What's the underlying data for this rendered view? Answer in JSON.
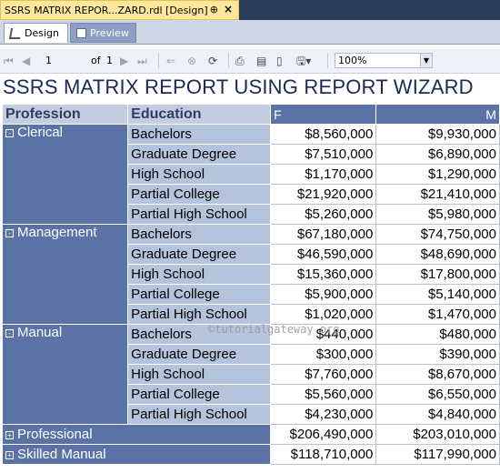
{
  "document_tab": {
    "title": "SSRS MATRIX REPOR...ZARD.rdl [Design]",
    "pin": "⊕",
    "close": "×"
  },
  "view_tabs": {
    "design": "Design",
    "preview": "Preview"
  },
  "toolbar": {
    "page": "1",
    "of_label": "of",
    "page_total": "1",
    "zoom": "100%"
  },
  "report": {
    "title": "SSRS MATRIX REPORT USING REPORT WIZARD",
    "headers": {
      "profession": "Profession",
      "education": "Education",
      "col_f": "F",
      "col_m": "M"
    },
    "groups": [
      {
        "profession": "Clerical",
        "toggle": "-",
        "rows": [
          {
            "education": "Bachelors",
            "f": "$8,560,000",
            "m": "$9,930,000"
          },
          {
            "education": "Graduate Degree",
            "f": "$7,510,000",
            "m": "$6,890,000"
          },
          {
            "education": "High School",
            "f": "$1,170,000",
            "m": "$1,290,000"
          },
          {
            "education": "Partial College",
            "f": "$21,920,000",
            "m": "$21,410,000"
          },
          {
            "education": "Partial High School",
            "f": "$5,260,000",
            "m": "$5,980,000"
          }
        ]
      },
      {
        "profession": "Management",
        "toggle": "-",
        "rows": [
          {
            "education": "Bachelors",
            "f": "$67,180,000",
            "m": "$74,750,000"
          },
          {
            "education": "Graduate Degree",
            "f": "$46,590,000",
            "m": "$48,690,000"
          },
          {
            "education": "High School",
            "f": "$15,360,000",
            "m": "$17,800,000"
          },
          {
            "education": "Partial College",
            "f": "$5,900,000",
            "m": "$5,140,000"
          },
          {
            "education": "Partial High School",
            "f": "$1,020,000",
            "m": "$1,470,000"
          }
        ]
      },
      {
        "profession": "Manual",
        "toggle": "-",
        "rows": [
          {
            "education": "Bachelors",
            "f": "$440,000",
            "m": "$480,000"
          },
          {
            "education": "Graduate Degree",
            "f": "$300,000",
            "m": "$390,000"
          },
          {
            "education": "High School",
            "f": "$7,760,000",
            "m": "$8,670,000"
          },
          {
            "education": "Partial College",
            "f": "$5,560,000",
            "m": "$6,550,000"
          },
          {
            "education": "Partial High School",
            "f": "$4,230,000",
            "m": "$4,840,000"
          }
        ]
      }
    ],
    "collapsed": [
      {
        "profession": "Professional",
        "toggle": "+",
        "f": "$206,490,000",
        "m": "$203,010,000"
      },
      {
        "profession": "Skilled Manual",
        "toggle": "+",
        "f": "$118,710,000",
        "m": "$117,990,000"
      }
    ],
    "watermark": "©tutorialgateway.org"
  },
  "colors": {
    "header_blue": "#5a72a5",
    "edu_blue": "#b5c3dc",
    "title_blue": "#1a2a55",
    "tab_gold": "#fde89a"
  }
}
